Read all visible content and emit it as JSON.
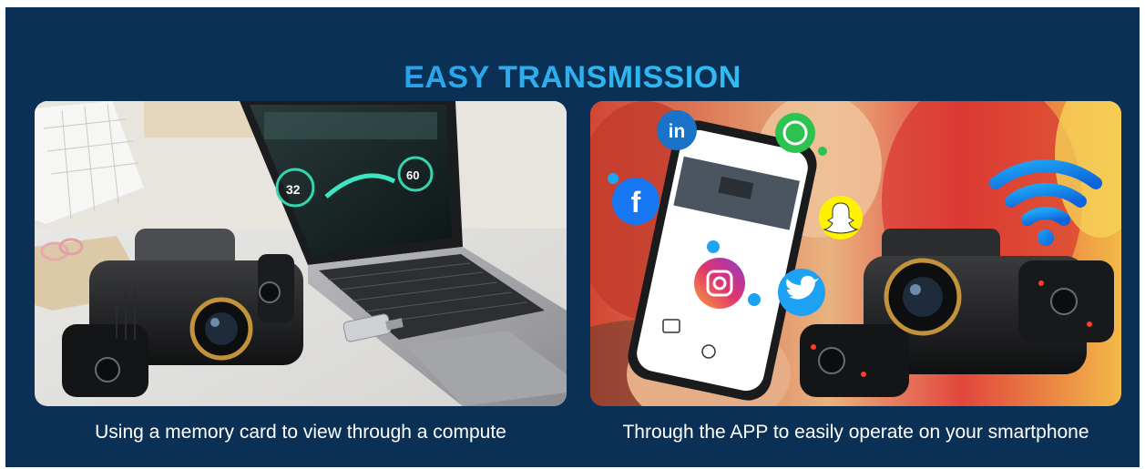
{
  "banner": {
    "title": "EASY TRANSMISSION",
    "accent_color": "#2fb6f0",
    "background_color": "#0b3056"
  },
  "panels": [
    {
      "caption": "Using a memory card to view through a compute",
      "scene": [
        "laptop-with-dashcam-video",
        "dashcam-device",
        "usb-card-reader"
      ]
    },
    {
      "caption": "Through the APP to easily operate on your smartphone",
      "scene": [
        "smartphone-app",
        "dashcam-device",
        "wifi-icon",
        "linkedin-icon",
        "whatsapp-icon",
        "facebook-icon",
        "snapchat-icon",
        "instagram-icon",
        "twitter-icon"
      ]
    }
  ]
}
